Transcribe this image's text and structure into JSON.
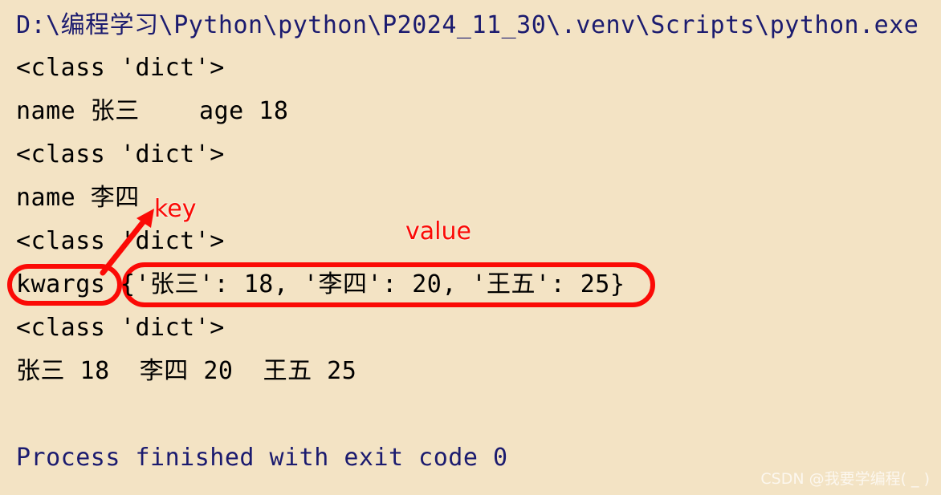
{
  "console": {
    "background_color": "#f3e3c4",
    "path_text_color": "#1b1b6f",
    "output_text_color": "#000000",
    "annotation_color": "#fb0a06",
    "lines": [
      {
        "id": "interpreter-path",
        "text": "D:\\编程学习\\Python\\python\\P2024_11_30\\.venv\\Scripts\\python.exe"
      },
      {
        "id": "type-line-1",
        "text": "<class 'dict'>"
      },
      {
        "id": "kv-line-1",
        "text": "name 张三    age 18"
      },
      {
        "id": "type-line-2",
        "text": "<class 'dict'>"
      },
      {
        "id": "kv-line-2",
        "text": "name 李四"
      },
      {
        "id": "type-line-3",
        "text": "<class 'dict'>"
      },
      {
        "id": "kwargs-label",
        "text": "kwargs"
      },
      {
        "id": "kwargs-dict",
        "text": "{'张三': 18, '李四': 20, '王五': 25}"
      },
      {
        "id": "type-line-4",
        "text": "<class 'dict'>"
      },
      {
        "id": "kv-line-3",
        "text": "张三 18  李四 20  王五 25"
      },
      {
        "id": "process-finished",
        "text": "Process finished with exit code 0"
      }
    ]
  },
  "annotations": {
    "key_label": "key",
    "value_label": "value",
    "arrow": "arrow-up-right-icon"
  },
  "watermark": {
    "text": "CSDN @我要学编程( _ )"
  }
}
